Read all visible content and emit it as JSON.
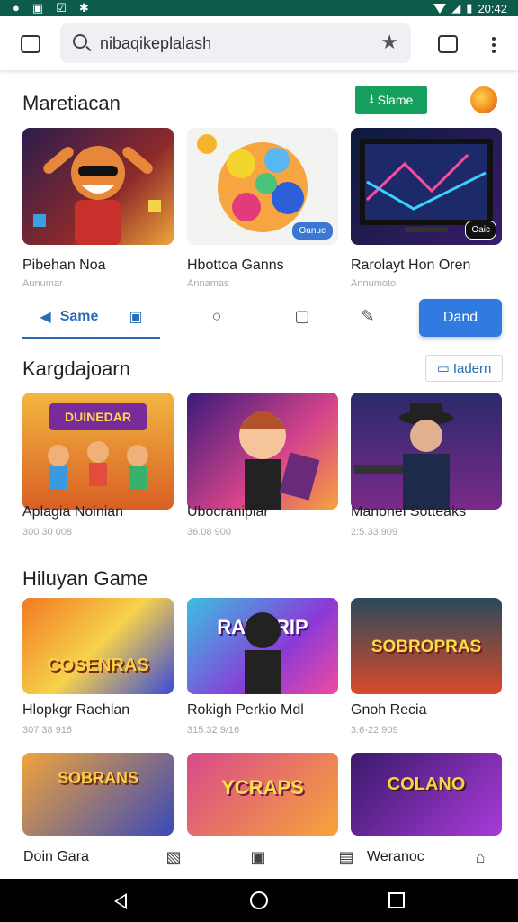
{
  "status": {
    "time": "20:42"
  },
  "search": {
    "text": "nibaqikeplalash"
  },
  "sections": [
    {
      "title": "Maretiacan",
      "button": "Slame",
      "cards": [
        {
          "title": "Pibehan Noa",
          "sub": "Aunumar"
        },
        {
          "title": "Hbottoa Ganns",
          "sub": "Annamas",
          "badge": "Oanuc"
        },
        {
          "title": "Rarolayt Hon Oren",
          "sub": "Annumoto",
          "badge": "Oaic"
        }
      ]
    },
    {
      "title": "Kargdajoarn",
      "link": "Iadern",
      "cards": [
        {
          "title": "Aplagia Noinian",
          "sub": "300 30 008",
          "banner": "DUINEDAR"
        },
        {
          "title": "Ubocraniplar",
          "sub": "36.08 900"
        },
        {
          "title": "Manonel Sotteaks",
          "sub": "2:5.33 909"
        }
      ]
    },
    {
      "title": "Hiluyan Game",
      "cards": [
        {
          "title": "Hlopkgr Raehlan",
          "sub": "307 38 916",
          "banner": "COSENRAS"
        },
        {
          "title": "Rokigh Perkio Mdl",
          "sub": "315.32 9/16",
          "banner": "RANORIP"
        },
        {
          "title": "Gnoh Recia",
          "sub": "3:6-22 909",
          "banner": "SOBROPRAS"
        }
      ]
    },
    {
      "cards": [
        {
          "banner": "SOBRANS"
        },
        {
          "banner": "YCRAPS"
        },
        {
          "banner": "COLANO"
        }
      ]
    }
  ],
  "tabs": {
    "active": "Same",
    "button": "Dand"
  },
  "bottom_nav": {
    "left": "Doin Gara",
    "right": "Weranoc"
  },
  "colors": {
    "status_bar": "#0d5c4a",
    "accent_blue": "#2a6db5",
    "button_blue": "#2f7be0",
    "green": "#16a05e"
  }
}
